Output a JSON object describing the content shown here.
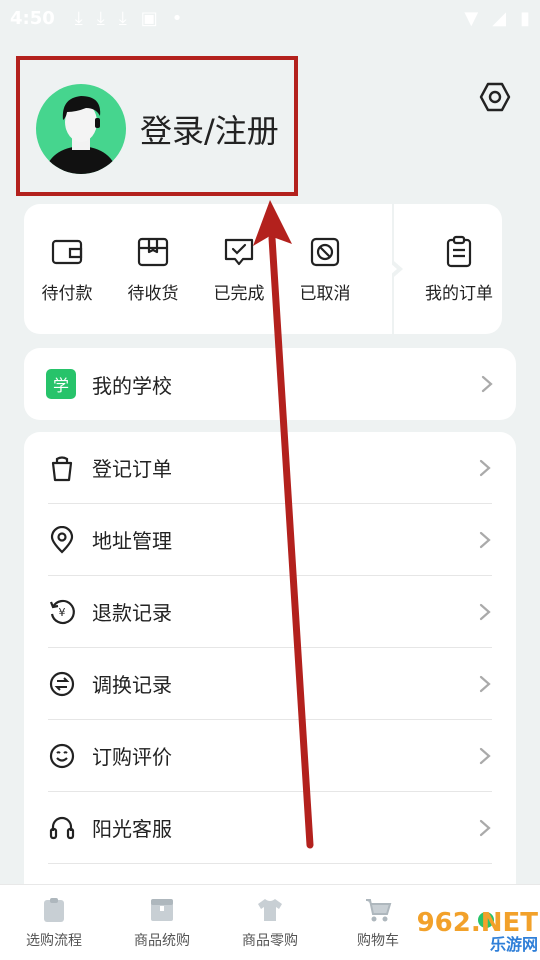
{
  "status_bar": {
    "time": "4:50"
  },
  "profile": {
    "login_label": "登录/注册"
  },
  "orders": {
    "items": [
      {
        "label": "待付款",
        "icon": "wallet-icon"
      },
      {
        "label": "待收货",
        "icon": "box-icon"
      },
      {
        "label": "已完成",
        "icon": "check-bubble-icon"
      },
      {
        "label": "已取消",
        "icon": "cancel-icon"
      }
    ],
    "my_orders": {
      "label": "我的订单",
      "icon": "clipboard-icon"
    }
  },
  "school": {
    "badge": "学",
    "label": "我的学校"
  },
  "menu": {
    "items": [
      {
        "label": "登记订单",
        "icon": "bag-icon"
      },
      {
        "label": "地址管理",
        "icon": "location-icon"
      },
      {
        "label": "退款记录",
        "icon": "refund-icon"
      },
      {
        "label": "调换记录",
        "icon": "exchange-icon"
      },
      {
        "label": "订购评价",
        "icon": "smile-icon"
      },
      {
        "label": "阳光客服",
        "icon": "headset-icon"
      }
    ]
  },
  "bottom_nav": {
    "items": [
      {
        "label": "选购流程",
        "icon": "clipboard-icon"
      },
      {
        "label": "商品统购",
        "icon": "box-icon"
      },
      {
        "label": "商品零购",
        "icon": "shirt-icon"
      },
      {
        "label": "购物车",
        "icon": "cart-icon"
      }
    ]
  },
  "watermark": {
    "top": "962.NET",
    "bottom": "乐游网"
  },
  "colors": {
    "accent": "#27c36a",
    "annotation": "#b3211d"
  }
}
